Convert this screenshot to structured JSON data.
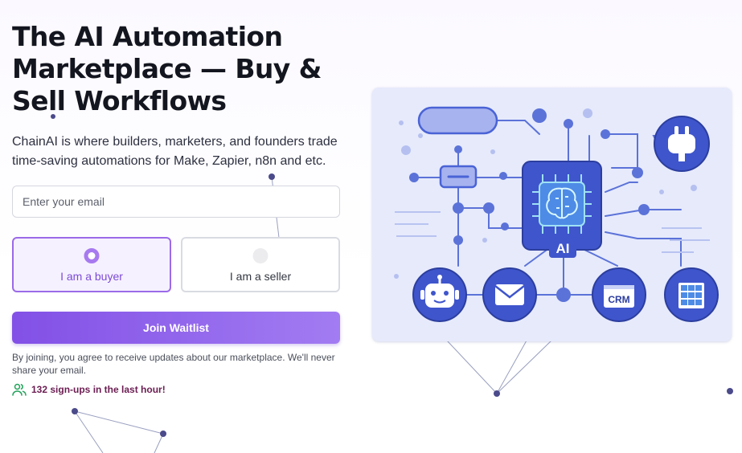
{
  "hero": {
    "title_line1": "The AI Automation",
    "title_line2": "Marketplace — Buy &",
    "title_line3": "Sell Workflows",
    "subtitle": "ChainAI is where builders, marketers, and founders trade time-saving automations for Make, Zapier, n8n and etc."
  },
  "form": {
    "email_placeholder": "Enter your email",
    "buyer_label": "I am a buyer",
    "seller_label": "I am a seller",
    "selected_role": "buyer",
    "join_label": "Join Waitlist",
    "disclaimer": "By joining, you agree to receive updates about our marketplace. We'll never share your email.",
    "signups_text": "132 sign-ups in the last hour!"
  },
  "illustration": {
    "chip_label": "AI",
    "crm_label": "CRM",
    "icons": [
      "robot-icon",
      "mail-icon",
      "crm-icon",
      "spreadsheet-icon",
      "plug-icon",
      "brain-chip-icon"
    ]
  },
  "colors": {
    "accent": "#8250e6",
    "accent_light": "#a27cf2",
    "illustration_bg": "#e6eafb",
    "node_blue": "#4a63d6",
    "signups_text": "#6b1d52",
    "signups_icon": "#22a35a"
  }
}
